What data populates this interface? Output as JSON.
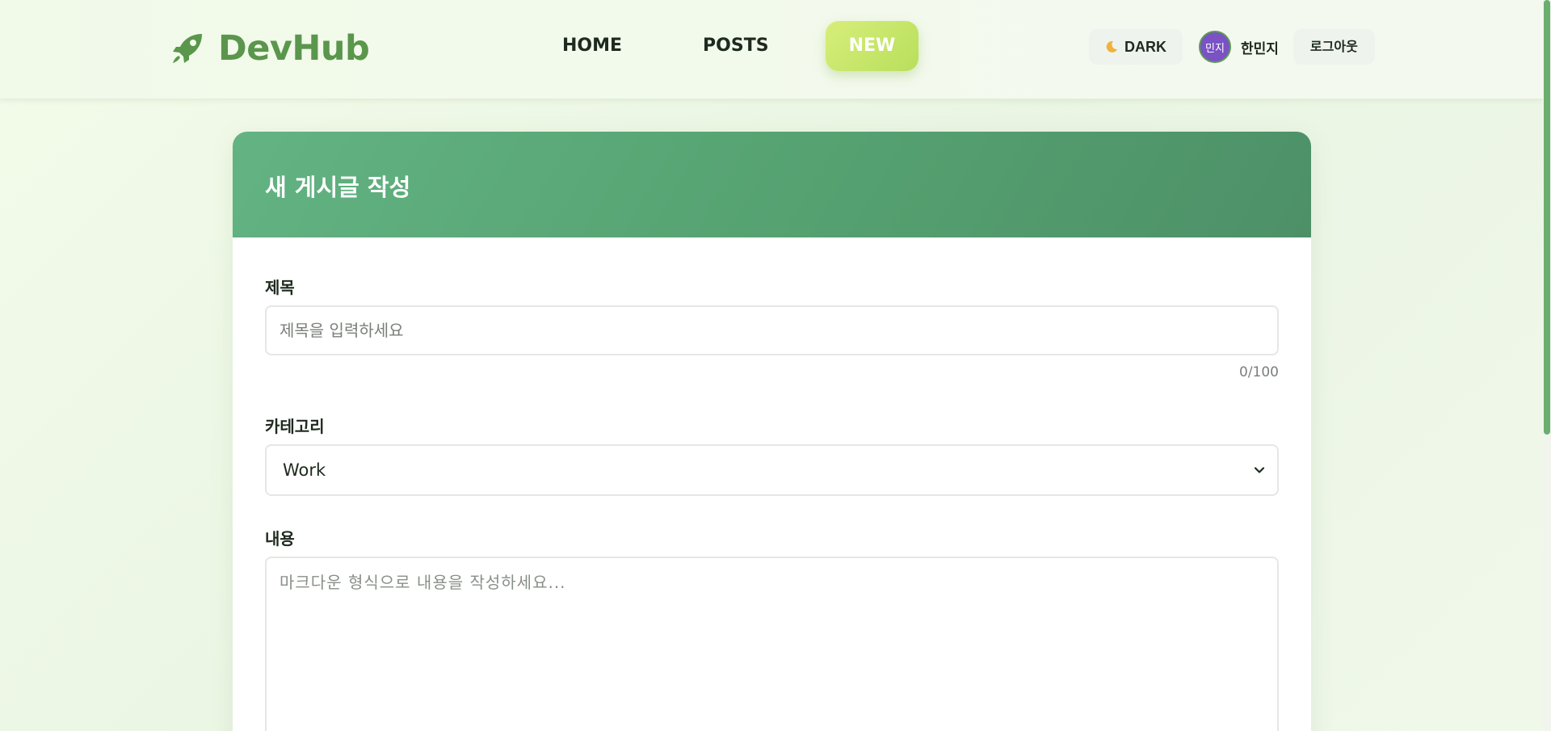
{
  "header": {
    "logo_text": "DevHub",
    "nav": [
      {
        "label": "HOME"
      },
      {
        "label": "POSTS"
      },
      {
        "label": "NEW",
        "active": true
      }
    ],
    "theme_toggle_label": "DARK",
    "user": {
      "avatar_text": "민지",
      "name": "한민지"
    },
    "logout_label": "로그아웃"
  },
  "form": {
    "heading": "새 게시글 작성",
    "title_field": {
      "label": "제목",
      "placeholder": "제목을 입력하세요",
      "value": "",
      "counter": "0/100"
    },
    "category_field": {
      "label": "카테고리",
      "selected": "Work"
    },
    "content_field": {
      "label": "내용",
      "placeholder": "마크다운 형식으로 내용을 작성하세요...",
      "value": ""
    }
  },
  "colors": {
    "brand": "#5a964c",
    "nav_active": "#c6e56a",
    "card_header": "#57a574",
    "avatar": "#7a52c4"
  },
  "icons": {
    "logo": "rocket-icon",
    "theme": "moon-icon",
    "select": "chevron-down-icon"
  }
}
